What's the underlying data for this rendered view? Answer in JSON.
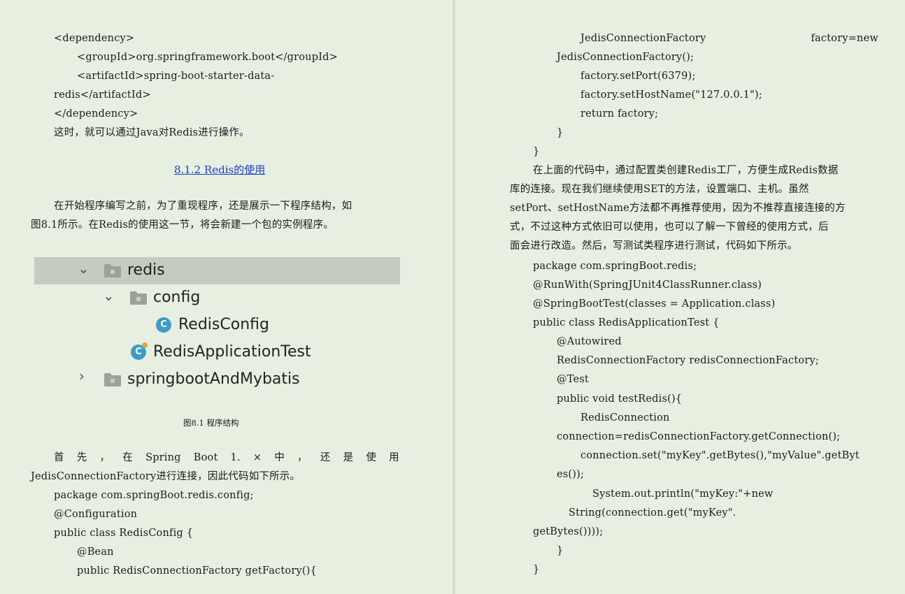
{
  "left": {
    "lines": [
      "<dependency>",
      "<groupId>org.springframework.boot</groupId>",
      "<artifactId>spring-boot-starter-data-",
      "redis</artifactId>",
      "</dependency>",
      "这时，就可以通过Java对Redis进行操作。"
    ],
    "heading": "8.1.2 Redis的使用",
    "para1_line1": "在开始程序编写之前，为了重现程序，还是展示一下程序结构，如",
    "para1_line2": "图8.1所示。在Redis的使用这一节，将会新建一个包的实例程序。",
    "tree": {
      "items": [
        {
          "label": "redis",
          "chevron": "⌄",
          "icon": "folder-icon"
        },
        {
          "label": "config",
          "chevron": "⌄",
          "icon": "folder-icon"
        },
        {
          "label": "RedisConfig",
          "icon": "class-icon",
          "badge": "C"
        },
        {
          "label": "RedisApplicationTest",
          "icon": "test-class-icon",
          "badge": "C"
        },
        {
          "label": "springbootAndMybatis",
          "chevron": "›",
          "icon": "folder-icon"
        }
      ]
    },
    "caption": "图8.1 程序结构",
    "para2_words": [
      "首",
      "先",
      "，",
      "在",
      "Spring",
      "Boot",
      "1.",
      "×",
      "中",
      "，",
      "还",
      "是",
      "使",
      "用"
    ],
    "para2_line2": "JedisConnectionFactory进行连接，因此代码如下所示。",
    "code": [
      "package com.springBoot.redis.config;",
      "@Configuration",
      "public class RedisConfig {",
      "@Bean",
      "public RedisConnectionFactory getFactory(){"
    ]
  },
  "right": {
    "code1_a": "JedisConnectionFactory",
    "code1_b": "factory=new",
    "code1": [
      "JedisConnectionFactory();",
      "factory.setPort(6379);",
      "factory.setHostName(\"127.0.0.1\");",
      "return factory;",
      "}",
      "}"
    ],
    "para": [
      "在上面的代码中，通过配置类创建Redis工厂，方便生成Redis数据",
      "库的连接。现在我们继续使用SET的方法，设置端口、主机。虽然",
      "setPort、setHostName方法都不再推荐使用，因为不推荐直接连接的方",
      "式，不过这种方式依旧可以使用，也可以了解一下曾经的使用方式，后",
      "面会进行改造。然后，写测试类程序进行测试，代码如下所示。"
    ],
    "code2": [
      "package com.springBoot.redis;",
      "@RunWith(SpringJUnit4ClassRunner.class)",
      "@SpringBootTest(classes = Application.class)",
      "public class RedisApplicationTest {",
      "@Autowired",
      "RedisConnectionFactory redisConnectionFactory;",
      "@Test",
      "public void testRedis(){",
      "RedisConnection",
      "connection=redisConnectionFactory.getConnection();",
      "connection.set(\"myKey\".getBytes(),\"myValue\".getByt",
      "es());",
      "System.out.println(\"myKey:\"+new",
      "String(connection.get(\"myKey\".",
      "getBytes())));",
      "}",
      "}"
    ]
  },
  "colors": {
    "page_bg": "#e7f0e0",
    "heading_link": "#1a3fcc",
    "tree_selected": "#c4cbbf",
    "class_icon": "#3d9bc7"
  }
}
